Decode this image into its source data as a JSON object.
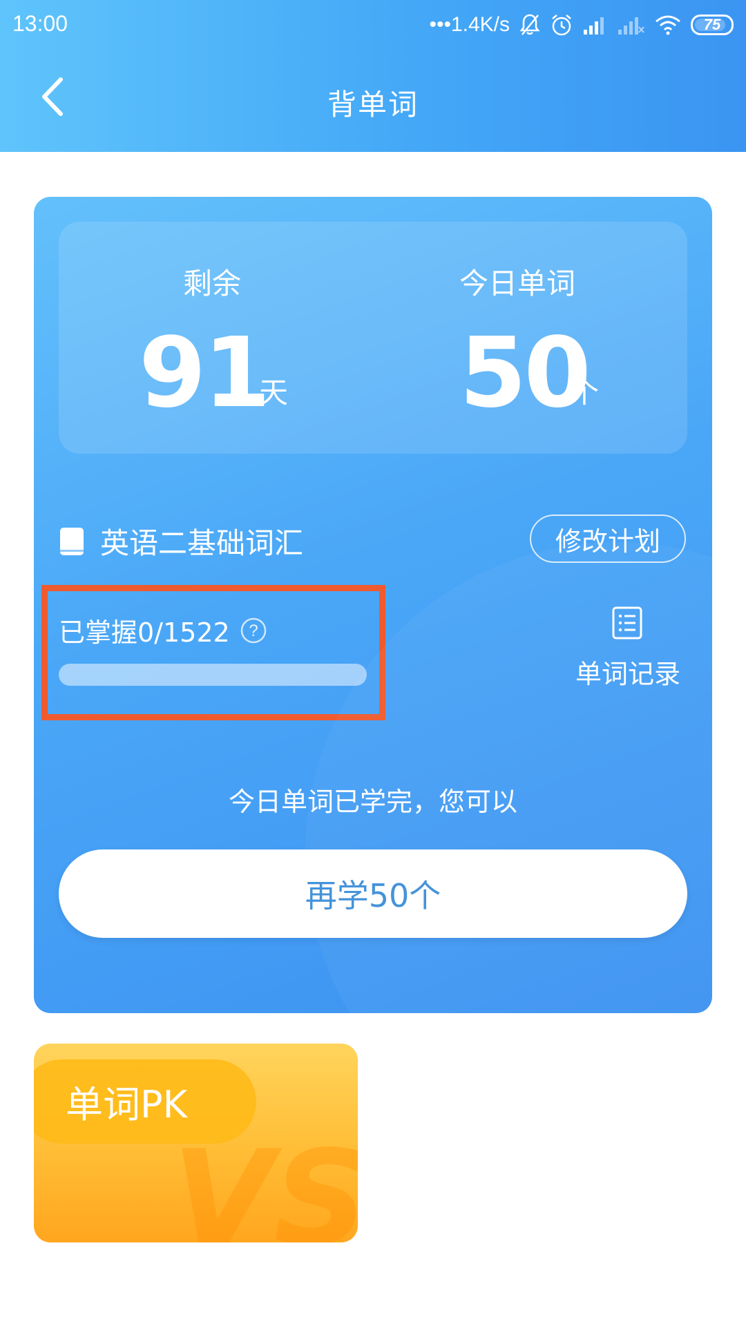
{
  "status_bar": {
    "time": "13:00",
    "network_speed": "•••1.4K/s",
    "battery": "75",
    "icons": [
      "bell-muted-icon",
      "alarm-icon",
      "signal-icon",
      "signal-weak-icon",
      "wifi-icon",
      "battery-icon"
    ]
  },
  "header": {
    "title": "背单词",
    "back_icon": "chevron-left-icon"
  },
  "stats": {
    "remaining_label": "剩余",
    "remaining_value": "91",
    "remaining_unit": "天",
    "today_label": "今日单词",
    "today_value": "50",
    "today_unit": "个"
  },
  "vocab": {
    "icon": "book-icon",
    "name": "英语二基础词汇",
    "edit_plan_label": "修改计划"
  },
  "progress": {
    "mastered_text": "已掌握0/1522",
    "mastered_count": 0,
    "total_count": 1522,
    "fraction": 0,
    "help_icon": "question-circle-icon"
  },
  "word_record": {
    "icon": "list-icon",
    "label": "单词记录"
  },
  "completion": {
    "message": "今日单词已学完，您可以",
    "learn_more_label": "再学50个"
  },
  "pk_card": {
    "label": "单词PK",
    "vs_icon": "vs-icon"
  },
  "colors": {
    "header_blue": "#44a8f7",
    "card_blue": "#4aa7f7",
    "button_text_blue": "#3d8fd8",
    "highlight_red": "#ef5a2e",
    "pk_orange": "#ffbd35"
  }
}
